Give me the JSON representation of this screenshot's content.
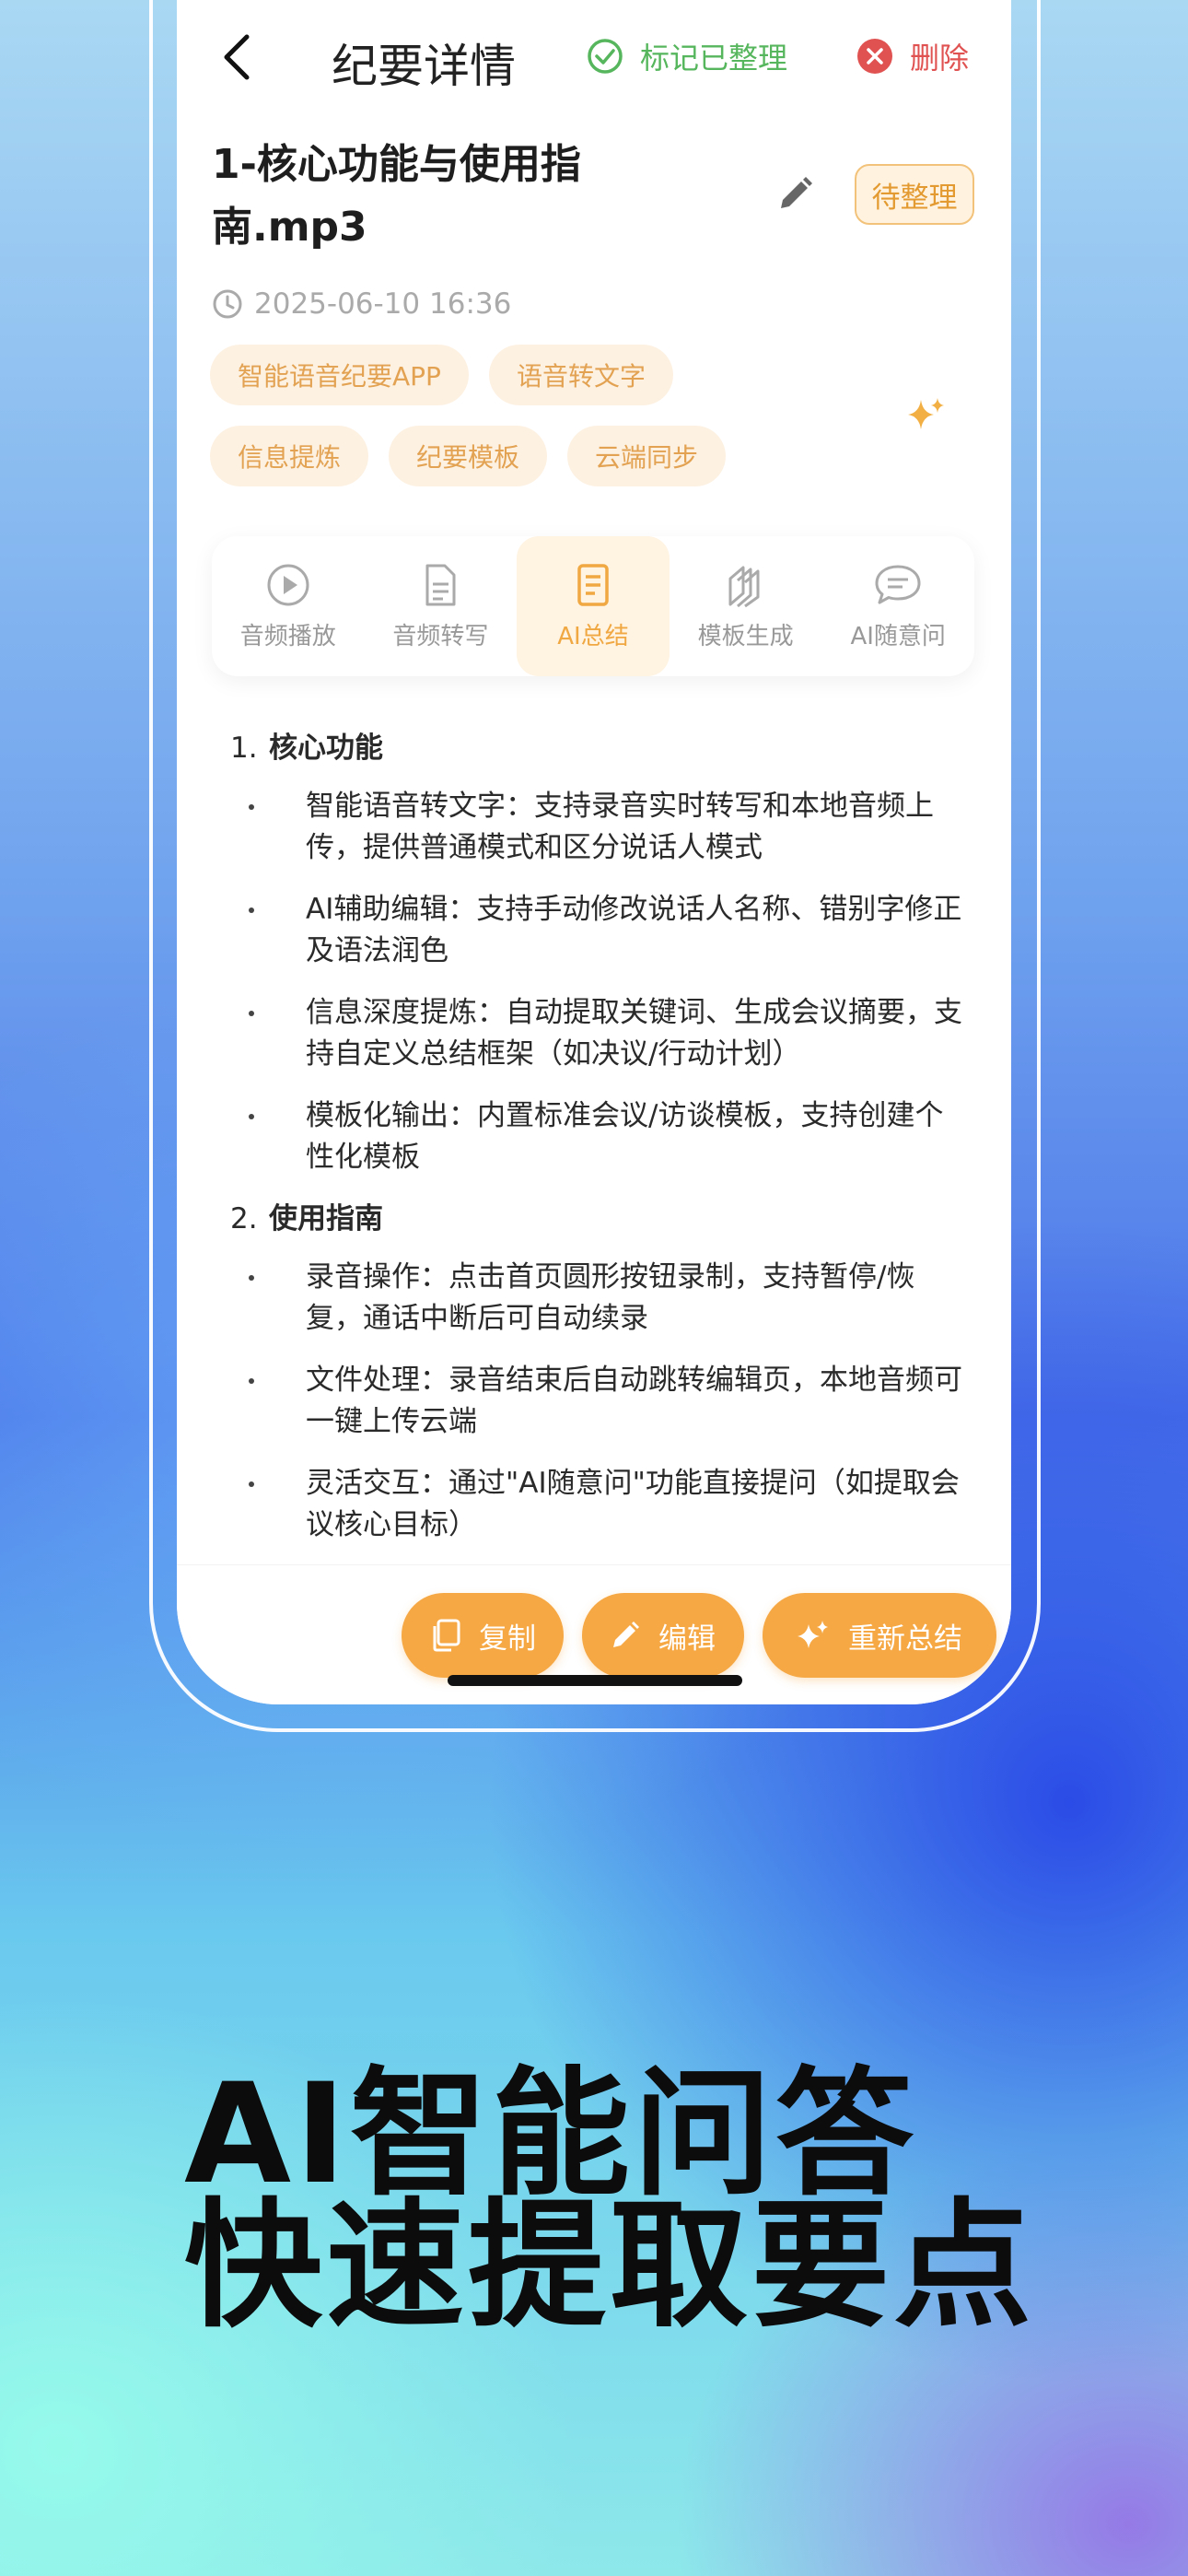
{
  "header": {
    "title": "纪要详情",
    "mark_label": "标记已整理",
    "delete_label": "删除"
  },
  "file": {
    "title": "1-核心功能与使用指南.mp3",
    "status": "待整理",
    "datetime": "2025-06-10 16:36"
  },
  "tags": [
    "智能语音纪要APP",
    "语音转文字",
    "信息提炼",
    "纪要模板",
    "云端同步"
  ],
  "tabs": [
    {
      "label": "音频播放",
      "icon": "play-icon"
    },
    {
      "label": "音频转写",
      "icon": "document-icon"
    },
    {
      "label": "AI总结",
      "icon": "summary-icon"
    },
    {
      "label": "模板生成",
      "icon": "template-icon"
    },
    {
      "label": "AI随意问",
      "icon": "chat-icon"
    }
  ],
  "summary": {
    "sections": [
      {
        "num": "1.",
        "heading": "核心功能",
        "items": [
          "智能语音转文字：支持录音实时转写和本地音频上传，提供普通模式和区分说话人模式",
          "AI辅助编辑：支持手动修改说话人名称、错别字修正及语法润色",
          "信息深度提炼：自动提取关键词、生成会议摘要，支持自定义总结框架（如决议/行动计划）",
          "模板化输出：内置标准会议/访谈模板，支持创建个性化模板"
        ]
      },
      {
        "num": "2.",
        "heading": "使用指南",
        "items": [
          "录音操作：点击首页圆形按钮录制，支持暂停/恢复，通话中断后可自动续录",
          "文件处理：录音结束后自动跳转编辑页，本地音频可一键上传云端",
          "灵活交互：通过\"AI随意问\"功能直接提问（如提取会议核心目标）"
        ]
      }
    ]
  },
  "actions": {
    "copy": "复制",
    "edit": "编辑",
    "resummarize": "重新总结"
  },
  "slogan": {
    "line1": "AI智能问答",
    "line2": "快速提取要点"
  },
  "colors": {
    "accent": "#f5a844",
    "success": "#56b65d",
    "danger": "#e05252"
  }
}
